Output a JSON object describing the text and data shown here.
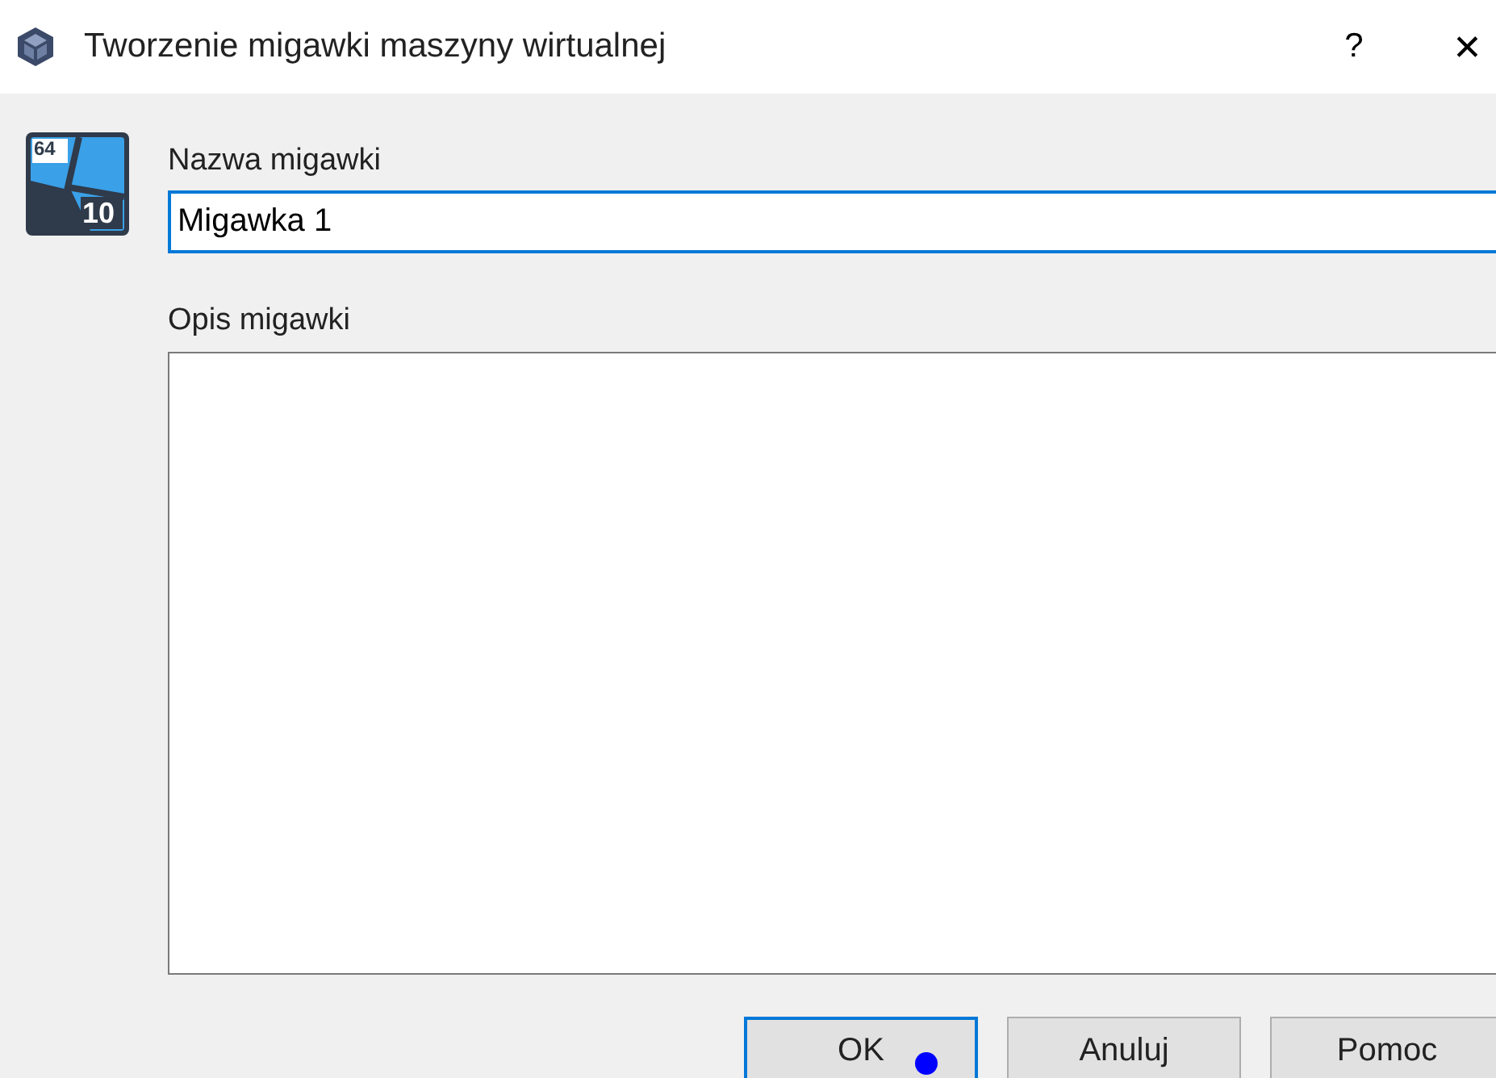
{
  "window": {
    "title": "Tworzenie migawki maszyny wirtualnej",
    "help": "?",
    "close": "✕"
  },
  "os_logo": {
    "bits": "64",
    "version": "10"
  },
  "name_field": {
    "label": "Nazwa migawki",
    "value": "Migawka 1",
    "focused": true
  },
  "description_field": {
    "label": "Opis migawki",
    "focused": false
  },
  "buttons": [
    {
      "label": "OK",
      "default": true
    },
    {
      "label": "Anuluj",
      "default": false
    },
    {
      "label": "Pomoc",
      "default": false
    }
  ]
}
